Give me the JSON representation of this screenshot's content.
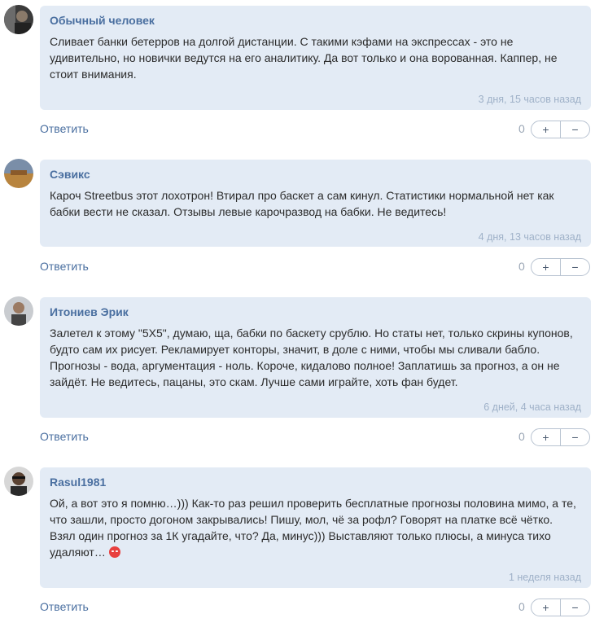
{
  "comments": [
    {
      "author": "Обычный человек",
      "lines": [
        "Сливает банки бетерров на долгой дистанции. С такими кэфами на экспрессах - это не",
        "удивительно, но новички ведутся на его аналитику. Да вот только и она ворованная. Каппер, не",
        "стоит внимания."
      ],
      "time": "3 дня, 15 часов назад",
      "reply": "Ответить",
      "score": "0",
      "plus": "+",
      "minus": "−"
    },
    {
      "author": "Сэвикс",
      "lines": [
        "Кароч Streetbus этот лохотрон! Втирал про баскет а сам кинул. Статистики нормальной нет как",
        "бабки вести не сказал. Отзывы левые карочразвод на бабки. Не ведитесь!"
      ],
      "time": "4 дня, 13 часов назад",
      "reply": "Ответить",
      "score": "0",
      "plus": "+",
      "minus": "−"
    },
    {
      "author": "Итониев Эрик",
      "lines": [
        "Залетел к этому \"5Х5\", думаю, ща, бабки по баскету срублю. Но статы нет, только скрины купонов,",
        "будто сам их рисует. Рекламирует конторы, значит, в доле с ними, чтобы мы сливали бабло.",
        "Прогнозы - вода, аргументация - ноль. Короче, кидалово полное! Заплатишь за прогноз, а он не",
        "зайдёт. Не ведитесь, пацаны, это скам. Лучше сами играйте, хоть фан будет."
      ],
      "time": "6 дней, 4 часа назад",
      "reply": "Ответить",
      "score": "0",
      "plus": "+",
      "minus": "−"
    },
    {
      "author": "Rasul1981",
      "lines": [
        "Ой, а вот это я помню…))) Как-то раз решил проверить бесплатные прогнозы половина мимо, а те,",
        "что зашли, просто догоном закрывались! Пишу, мол, чё за рофл? Говорят на платке всё чётко.",
        "Взял один прогноз за 1К угадайте, что? Да, минус))) Выставляют только плюсы, а минуса тихо",
        "удаляют…"
      ],
      "time": "1 неделя назад",
      "reply": "Ответить",
      "score": "0",
      "plus": "+",
      "minus": "−"
    }
  ],
  "emoji": "angry-face-icon"
}
